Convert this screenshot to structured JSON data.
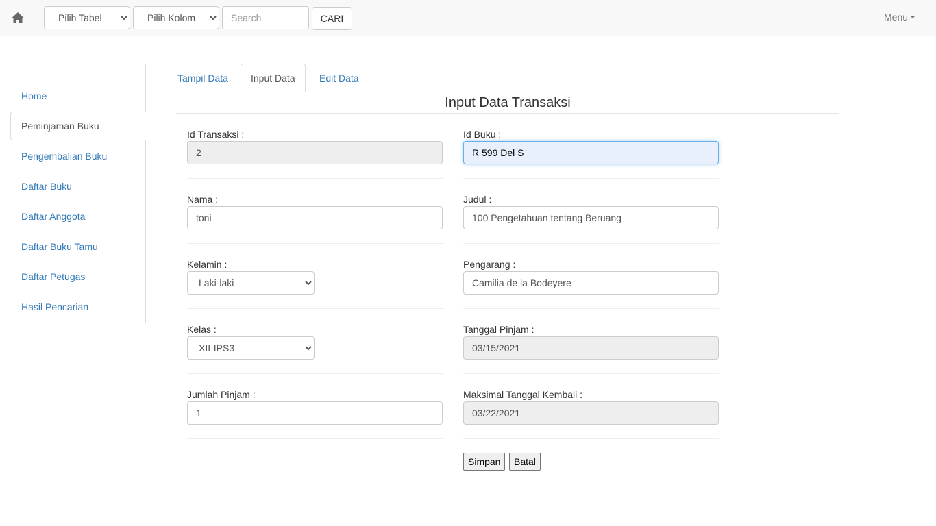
{
  "navbar": {
    "home_icon": "home-icon",
    "table_select": "Pilih Tabel",
    "column_select": "Pilih Kolom",
    "search_placeholder": "Search",
    "search_button": "CARI",
    "menu_label": "Menu"
  },
  "sidebar": {
    "items": [
      {
        "label": "Home"
      },
      {
        "label": "Peminjaman Buku"
      },
      {
        "label": "Pengembalian Buku"
      },
      {
        "label": "Daftar Buku"
      },
      {
        "label": "Daftar Anggota"
      },
      {
        "label": "Daftar Buku Tamu"
      },
      {
        "label": "Daftar Petugas"
      },
      {
        "label": "Hasil Pencarian"
      }
    ],
    "active_index": 1
  },
  "tabs": [
    {
      "label": "Tampil Data"
    },
    {
      "label": "Input Data"
    },
    {
      "label": "Edit Data"
    }
  ],
  "form": {
    "title": "Input Data Transaksi",
    "id_transaksi": {
      "label": "Id Transaksi :",
      "value": "2"
    },
    "id_buku": {
      "label": "Id Buku :",
      "value": "R 599 Del S"
    },
    "nama": {
      "label": "Nama :",
      "value": "toni"
    },
    "judul": {
      "label": "Judul :",
      "value": "100 Pengetahuan tentang Beruang"
    },
    "kelamin": {
      "label": "Kelamin :",
      "value": "Laki-laki"
    },
    "pengarang": {
      "label": "Pengarang :",
      "value": "Camilia de la Bodeyere"
    },
    "kelas": {
      "label": "Kelas :",
      "value": "XII-IPS3"
    },
    "tanggal_pinjam": {
      "label": "Tanggal Pinjam :",
      "value": "03/15/2021"
    },
    "jumlah_pinjam": {
      "label": "Jumlah Pinjam :",
      "value": "1"
    },
    "maks_tanggal_kembali": {
      "label": "Maksimal Tanggal Kembali :",
      "value": "03/22/2021"
    },
    "save_button": "Simpan",
    "cancel_button": "Batal"
  },
  "colors": {
    "link": "#337ab7",
    "navbar_bg": "#f8f8f8",
    "readonly_bg": "#eeeeee",
    "focus_border": "#66afe9"
  }
}
